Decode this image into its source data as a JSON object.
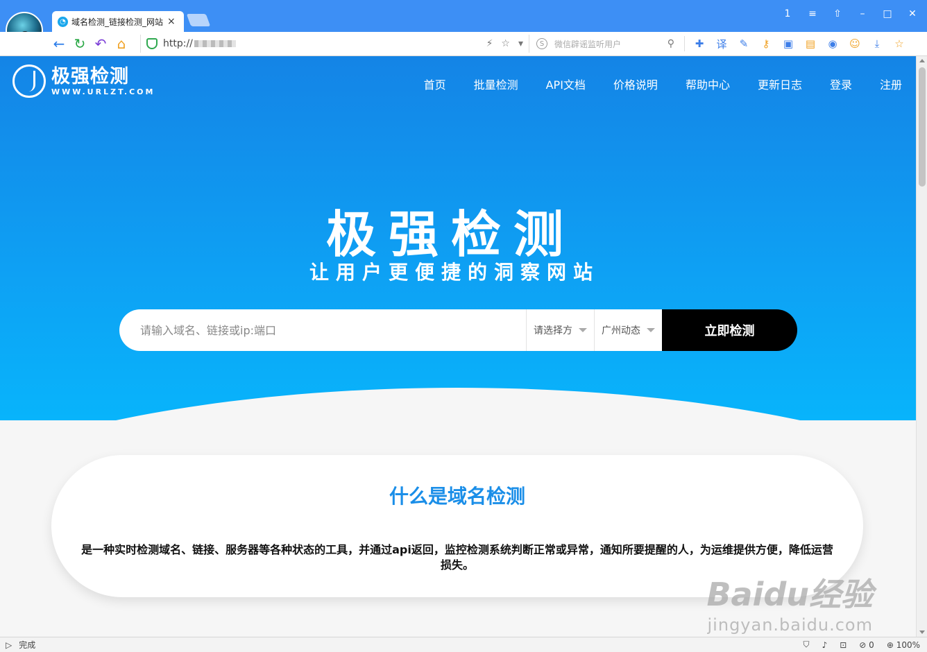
{
  "browser": {
    "tab_title": "域名检测_链接检测_网站",
    "tab_close": "×",
    "url_prefix": "http://",
    "window_controls": [
      "1",
      "≡",
      "⇧",
      "–",
      "□",
      "✕"
    ],
    "search_placeholder": "微信辟谣监听用户",
    "status_text": "完成",
    "zoom": "100%",
    "blocked_count": "0"
  },
  "site": {
    "logo_name": "极强检测",
    "logo_domain": "WWW.URLZT.COM",
    "nav": [
      "首页",
      "批量检测",
      "API文档",
      "价格说明",
      "帮助中心",
      "更新日志",
      "登录",
      "注册"
    ]
  },
  "hero": {
    "title": "极强检测",
    "subtitle": "让用户更便捷的洞察网站",
    "search_placeholder": "请输入域名、链接或ip:端口",
    "select_method": "请选择方",
    "select_node": "广州动态",
    "submit": "立即检测"
  },
  "card": {
    "title": "什么是域名检测",
    "body": "是一种实时检测域名、链接、服务器等各种状态的工具，并通过api返回，监控检测系统判断正常或异常，通知所要提醒的人，为运维提供方便，降低运营损失。"
  },
  "watermark": {
    "brand": "Baidu经验",
    "url": "jingyan.baidu.com"
  },
  "colors": {
    "hero_top": "#1484e6",
    "hero_bottom": "#08b4fb",
    "accent": "#1a8ee8",
    "submit_bg": "#000000"
  }
}
